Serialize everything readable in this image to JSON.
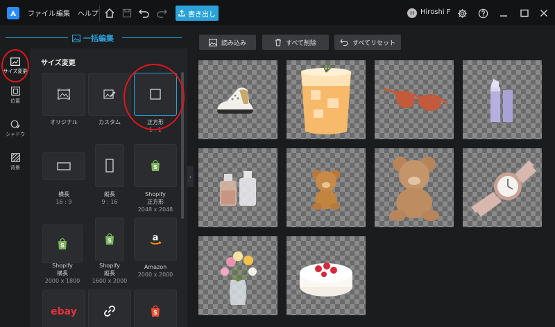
{
  "menu": {
    "file": "ファイル",
    "edit": "編集",
    "help": "ヘルプ"
  },
  "export_label": "書き出し",
  "user": {
    "initial": "H",
    "name": "Hiroshi F"
  },
  "panel_title": "一括編集",
  "rail": [
    {
      "label": "サイズ変更"
    },
    {
      "label": "位置"
    },
    {
      "label": "シャドウ"
    },
    {
      "label": "背景"
    }
  ],
  "section_title": "サイズ変更",
  "presets": [
    {
      "name": "オリジナル",
      "sub": ""
    },
    {
      "name": "カスタム",
      "sub": ""
    },
    {
      "name": "正方形",
      "sub": "1 : 1"
    },
    {
      "name": "横長",
      "sub": "16 : 9"
    },
    {
      "name": "縦長",
      "sub": "9 : 16"
    },
    {
      "name": "Shopify",
      "name2": "正方形",
      "sub": "2048 x 2048"
    },
    {
      "name": "Shopify",
      "name2": "横長",
      "sub": "2000 x 1800"
    },
    {
      "name": "Shopify",
      "name2": "縦長",
      "sub": "1600 x 2000"
    },
    {
      "name": "Amazon",
      "sub": "2000 x 2000"
    }
  ],
  "brand_icons": {
    "ebay": "ebay",
    "amazon": "a"
  },
  "actions": {
    "load": "読み込み",
    "delete_all": "すべて削除",
    "reset_all": "すべてリセット"
  },
  "images": [
    {
      "subject": "sneaker"
    },
    {
      "subject": "iced-drink"
    },
    {
      "subject": "sunglasses"
    },
    {
      "subject": "lipstick"
    },
    {
      "subject": "perfume-bottles"
    },
    {
      "subject": "teddy-bear-small"
    },
    {
      "subject": "teddy-bear-large"
    },
    {
      "subject": "wristwatch"
    },
    {
      "subject": "flower-vase"
    },
    {
      "subject": "strawberry-cake"
    }
  ],
  "colors": {
    "accent": "#2aa3d9",
    "annotation": "#e0161d",
    "shopify": "#7ab55c"
  }
}
